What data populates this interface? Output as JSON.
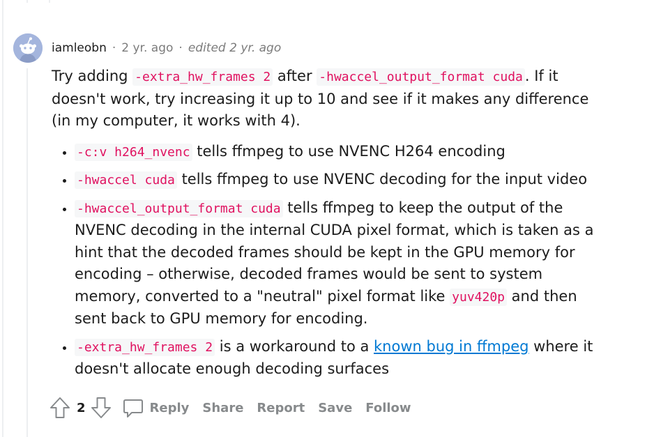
{
  "comment": {
    "author": "iamleobn",
    "separator": "·",
    "time": "2 yr. ago",
    "edited": "edited 2 yr. ago",
    "intro": {
      "t1": "Try adding ",
      "c1": "-extra_hw_frames 2",
      "t2": " after ",
      "c2": "-hwaccel_output_format cuda",
      "t3": ". If it doesn't work, try increasing it up to 10 and see if it makes any difference (in my computer, it works with 4)."
    },
    "bullets": [
      {
        "code": "-c:v h264_nvenc",
        "text": " tells ffmpeg to use NVENC H264 encoding"
      },
      {
        "code": "-hwaccel cuda",
        "text": " tells ffmpeg to use NVENC decoding for the input video"
      },
      {
        "code": "-hwaccel_output_format cuda",
        "text": " tells ffmpeg to keep the output of the NVENC decoding in the internal CUDA pixel format, which is taken as a hint that the decoded frames should be kept in the GPU memory for encoding – otherwise, decoded frames would be sent to system memory, converted to a \"neutral\" pixel format like ",
        "code2": "yuv420p",
        "text2": " and then sent back to GPU memory for encoding."
      },
      {
        "code": "-extra_hw_frames 2",
        "text": " is a workaround to a ",
        "link": "known bug in ffmpeg",
        "text2": " where it doesn't allocate enough decoding surfaces"
      }
    ]
  },
  "footer": {
    "vote_count": "2",
    "reply_label": "Reply",
    "share_label": "Share",
    "report_label": "Report",
    "save_label": "Save",
    "follow_label": "Follow"
  },
  "colors": {
    "code_text": "#e0115f",
    "code_bg": "#f6f7f8",
    "link": "#0079d3",
    "meta_gray": "#7c7c7c",
    "action_gray": "#878a8c",
    "avatar_bg": "#a4b5dd"
  },
  "icons": [
    "reddit-avatar-icon",
    "upvote-icon",
    "downvote-icon",
    "comment-bubble-icon"
  ]
}
